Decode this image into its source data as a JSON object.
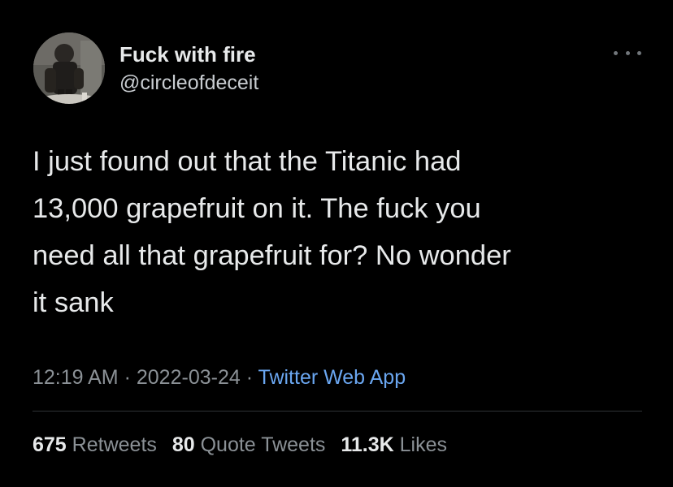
{
  "tweet": {
    "author_name": "Fuck with fire",
    "author_handle": "@circleofdeceit",
    "text_lines": [
      "I just found out that the Titanic had",
      "13,000 grapefruit on it. The fuck you",
      "need all that grapefruit for? No wonder",
      "it sank"
    ],
    "time": "12:19 AM",
    "date": "2022-03-24",
    "separator": "·",
    "source": "Twitter Web App",
    "stats": {
      "retweets_count": "675",
      "retweets_label": "Retweets",
      "quotes_count": "80",
      "quotes_label": "Quote Tweets",
      "likes_count": "11.3K",
      "likes_label": "Likes"
    }
  },
  "colors": {
    "background": "#000000",
    "primary_text": "#e7e9ea",
    "secondary_text": "#8b9196",
    "link": "#6aa6f0",
    "divider": "#2f3336"
  },
  "icons": {
    "more_menu": "more-horizontal-icon"
  }
}
